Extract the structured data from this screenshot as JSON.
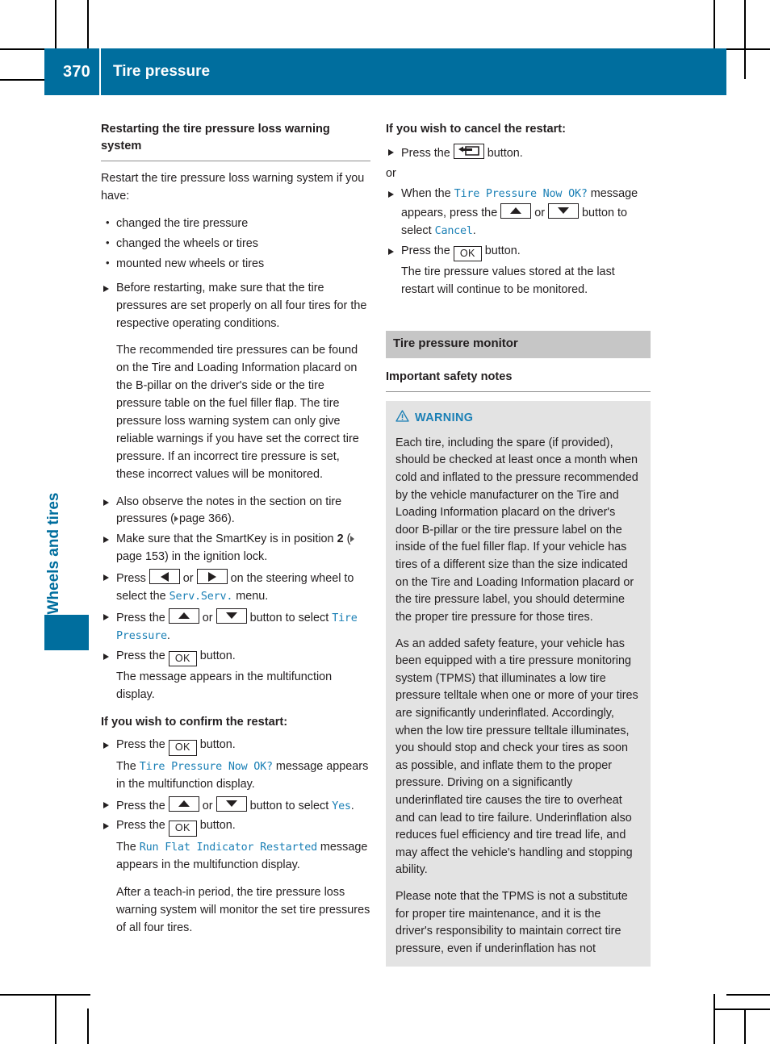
{
  "page": {
    "number": "370",
    "header_title": "Tire pressure",
    "chapter_tab": "Wheels and tires",
    "header_color": "#006e9e",
    "display_text_color": "#1a7fb5",
    "section_bar_color": "#c6c6c6",
    "warning_box_color": "#e3e3e3"
  },
  "left_column": {
    "heading": "Restarting the tire pressure loss warning system",
    "intro": "Restart the tire pressure loss warning system if you have:",
    "bullets": [
      "changed the tire pressure",
      "changed the wheels or tires",
      "mounted new wheels or tires"
    ],
    "step_before_restart": "Before restarting, make sure that the tire pressures are set properly on all four tires for the respective operating conditions.",
    "paragraph_recommended": "The recommended tire pressures can be found on the Tire and Loading Information placard on the B-pillar on the driver's side or the tire pressure table on the fuel filler flap. The tire pressure loss warning system can only give reliable warnings if you have set the correct tire pressure. If an incorrect tire pressure is set, these incorrect values will be monitored.",
    "step_observe_prefix": "Also observe the notes in the section on tire pressures (",
    "step_observe_page": "page 366",
    "step_observe_suffix": ").",
    "step_smartkey_prefix": "Make sure that the SmartKey is in position ",
    "step_smartkey_bold": "2",
    "step_smartkey_mid": " (",
    "step_smartkey_page": "page 153",
    "step_smartkey_suffix": ") in the ignition lock.",
    "step_press_prefix": "Press ",
    "step_press_or": " or ",
    "step_press_suffix": " on the steering wheel to select the ",
    "step_press_menu": "Serv.Serv.",
    "step_press_end": " menu.",
    "step_updown_prefix": "Press the ",
    "step_updown_or": " or ",
    "step_updown_suffix": " button to select ",
    "step_updown_target": "Tire Pressure",
    "step_updown_end": ".",
    "step_ok_prefix": "Press the ",
    "step_ok_suffix": " button.",
    "step_ok_result": "The message appears in the multifunction display.",
    "confirm_heading": "If you wish to confirm the restart:",
    "confirm_ok_prefix": "Press the ",
    "confirm_ok_suffix": " button.",
    "confirm_result_prefix": "The ",
    "confirm_result_msg": "Tire Pressure Now OK?",
    "confirm_result_suffix": " message appears in the multifunction display.",
    "confirm_updown_prefix": "Press the ",
    "confirm_updown_or": " or ",
    "confirm_updown_suffix": " button to select ",
    "confirm_updown_target": "Yes",
    "confirm_updown_end": ".",
    "confirm_ok2_prefix": "Press the ",
    "confirm_ok2_suffix": " button.",
    "confirm_restarted_prefix": "The ",
    "confirm_restarted_msg": "Run Flat Indicator Restarted",
    "confirm_restarted_suffix": " message appears in the multifunction display.",
    "confirm_teachin": "After a teach-in period, the tire pressure loss warning system will monitor the set tire pressures of all four tires."
  },
  "right_column": {
    "cancel_heading": "If you wish to cancel the restart:",
    "cancel_back_prefix": "Press the ",
    "cancel_back_suffix": " button.",
    "or_label": "or",
    "cancel_when_prefix": "When the ",
    "cancel_when_msg": "Tire Pressure Now OK?",
    "cancel_when_mid": " message appears, press the ",
    "cancel_when_or": " or ",
    "cancel_when_suffix": " button to select ",
    "cancel_when_target": "Cancel",
    "cancel_when_end": ".",
    "cancel_ok_prefix": "Press the ",
    "cancel_ok_suffix": " button.",
    "cancel_ok_result": "The tire pressure values stored at the last restart will continue to be monitored.",
    "section_title": "Tire pressure monitor",
    "safety_heading": "Important safety notes",
    "warning_label": "WARNING",
    "warning_paragraphs": [
      "Each tire, including the spare (if provided), should be checked at least once a month when cold and inflated to the pressure recommended by the vehicle manufacturer on the Tire and Loading Information placard on the driver's door B-pillar or the tire pressure label on the inside of the fuel filler flap. If your vehicle has tires of a different size than the size indicated on the Tire and Loading Information placard or the tire pressure label, you should determine the proper tire pressure for those tires.",
      "As an added safety feature, your vehicle has been equipped with a tire pressure monitoring system (TPMS) that illuminates a low tire pressure telltale when one or more of your tires are significantly underinflated. Accordingly, when the low tire pressure telltale illuminates, you should stop and check your tires as soon as possible, and inflate them to the proper pressure. Driving on a significantly underinflated tire causes the tire to overheat and can lead to tire failure. Underinflation also reduces fuel efficiency and tire tread life, and may affect the vehicle's handling and stopping ability.",
      "Please note that the TPMS is not a substitute for proper tire maintenance, and it is the driver's responsibility to maintain correct tire pressure, even if underinflation has not"
    ]
  },
  "keys": {
    "ok": "OK",
    "up": "up-arrow-key",
    "down": "down-arrow-key",
    "left": "left-arrow-key",
    "right": "right-arrow-key",
    "back": "back-key"
  }
}
